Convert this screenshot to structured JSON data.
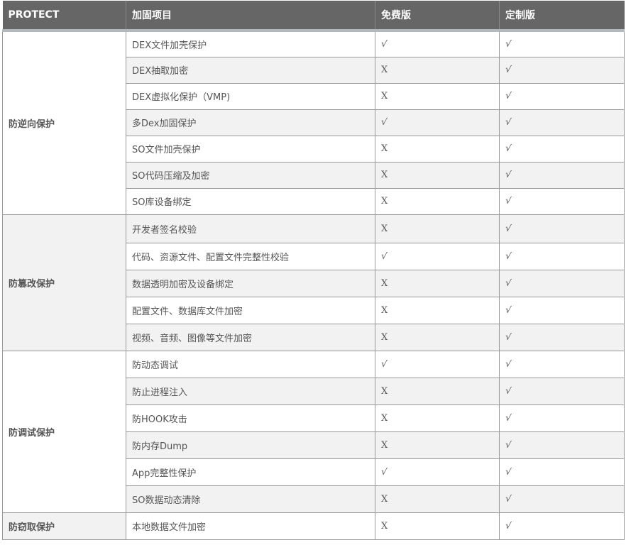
{
  "header": {
    "col_protect": "PROTECT",
    "col_item": "加固项目",
    "col_free": "免费版",
    "col_custom": "定制版"
  },
  "colors": {
    "header_bg": "#666666",
    "header_text": "#ffffff",
    "stripe": "#f2f2f2",
    "border": "#999999"
  },
  "categories": [
    {
      "name": "防逆向保护",
      "rows": [
        {
          "item": "DEX文件加壳保护",
          "free": "√",
          "custom": "√"
        },
        {
          "item": "DEX抽取加密",
          "free": "X",
          "custom": "√"
        },
        {
          "item": "DEX虚拟化保护（VMP)",
          "free": "X",
          "custom": "√"
        },
        {
          "item": "多Dex加固保护",
          "free": "√",
          "custom": "√"
        },
        {
          "item": "SO文件加壳保护",
          "free": "X",
          "custom": "√"
        },
        {
          "item": "SO代码压缩及加密",
          "free": "X",
          "custom": "√"
        },
        {
          "item": "SO库设备绑定",
          "free": "X",
          "custom": "√"
        }
      ]
    },
    {
      "name": "防篡改保护",
      "rows": [
        {
          "item": "开发者签名校验",
          "free": "X",
          "custom": "√"
        },
        {
          "item": "代码、资源文件、配置文件完整性校验",
          "free": "√",
          "custom": "√"
        },
        {
          "item": "数据透明加密及设备绑定",
          "free": "X",
          "custom": "√"
        },
        {
          "item": "配置文件、数据库文件加密",
          "free": "X",
          "custom": "√"
        },
        {
          "item": "视频、音频、图像等文件加密",
          "free": "X",
          "custom": "√"
        }
      ]
    },
    {
      "name": "防调试保护",
      "rows": [
        {
          "item": "防动态调试",
          "free": "√",
          "custom": "√"
        },
        {
          "item": "防止进程注入",
          "free": "X",
          "custom": "√"
        },
        {
          "item": "防HOOK攻击",
          "free": "X",
          "custom": "√"
        },
        {
          "item": "防内存Dump",
          "free": "X",
          "custom": "√"
        },
        {
          "item": "App完整性保护",
          "free": "√",
          "custom": "√"
        },
        {
          "item": "SO数据动态清除",
          "free": "X",
          "custom": "√"
        }
      ]
    },
    {
      "name": "防窃取保护",
      "rows": [
        {
          "item": "本地数据文件加密",
          "free": "X",
          "custom": "√"
        }
      ]
    }
  ]
}
